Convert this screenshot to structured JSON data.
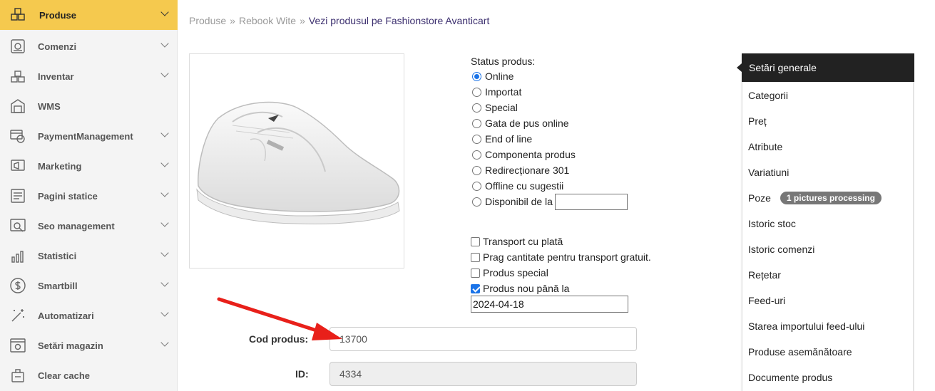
{
  "sidebar": {
    "items": [
      {
        "label": "Produse",
        "icon": "boxes-icon",
        "chevron": true
      },
      {
        "label": "Comenzi",
        "icon": "register-icon",
        "chevron": true
      },
      {
        "label": "Inventar",
        "icon": "stack-icon",
        "chevron": true
      },
      {
        "label": "WMS",
        "icon": "warehouse-icon",
        "chevron": false
      },
      {
        "label": "PaymentManagement",
        "icon": "payment-icon",
        "chevron": true
      },
      {
        "label": "Marketing",
        "icon": "megaphone-icon",
        "chevron": true
      },
      {
        "label": "Pagini statice",
        "icon": "pages-icon",
        "chevron": true
      },
      {
        "label": "Seo management",
        "icon": "seo-icon",
        "chevron": true
      },
      {
        "label": "Statistici",
        "icon": "stats-icon",
        "chevron": true
      },
      {
        "label": "Smartbill",
        "icon": "dollar-icon",
        "chevron": true
      },
      {
        "label": "Automatizari",
        "icon": "magic-wand-icon",
        "chevron": true
      },
      {
        "label": "Setări magazin",
        "icon": "settings-icon",
        "chevron": true
      },
      {
        "label": "Clear cache",
        "icon": "clear-cache-icon",
        "chevron": false
      }
    ]
  },
  "breadcrumb": {
    "items": [
      "Produse",
      "Rebook Wite"
    ],
    "separator": "»",
    "current": "Vezi produsul pe Fashionstore Avanticart"
  },
  "status": {
    "title": "Status produs:",
    "options": [
      "Online",
      "Importat",
      "Special",
      "Gata de pus online",
      "End of line",
      "Componenta produs",
      "Redirecționare 301",
      "Offline cu sugestii",
      "Disponibil de la"
    ],
    "selected": "Online"
  },
  "checkboxes": [
    {
      "label": "Transport cu plată",
      "checked": false
    },
    {
      "label": "Prag cantitate pentru transport gratuit.",
      "checked": false
    },
    {
      "label": "Produs special",
      "checked": false
    },
    {
      "label": "Produs nou până la",
      "checked": true
    }
  ],
  "new_until_date": "2024-04-18",
  "form": {
    "cod_label": "Cod produs:",
    "cod_value": "13700",
    "id_label": "ID:",
    "id_value": "4334"
  },
  "right_menu": {
    "header": "Setări generale",
    "items": [
      "Categorii",
      "Preț",
      "Atribute",
      "Variatiuni",
      "Poze",
      "Istoric stoc",
      "Istoric comenzi",
      "Rețetar",
      "Feed-uri",
      "Starea importului feed-ului",
      "Produse asemănătoare",
      "Documente produs"
    ],
    "poze_badge": "1 pictures processing"
  },
  "colors": {
    "active_sidebar": "#f5c94e",
    "arrow": "#e8201a",
    "menu_header": "#222222",
    "checkbox_accent": "#1a73e8"
  }
}
